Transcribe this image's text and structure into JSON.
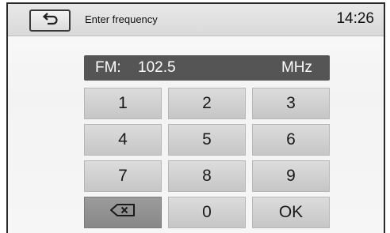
{
  "header": {
    "back_icon": "back-arrow-icon",
    "title": "Enter frequency",
    "time": "14:26"
  },
  "display": {
    "band": "FM:",
    "frequency": "102.5",
    "unit": "MHz"
  },
  "keypad": {
    "keys": [
      "1",
      "2",
      "3",
      "4",
      "5",
      "6",
      "7",
      "8",
      "9"
    ],
    "backspace_icon": "backspace-icon",
    "zero": "0",
    "ok": "OK"
  },
  "colors": {
    "display_background": "#555555",
    "key_background": "#d0d0d0",
    "backspace_key_background": "#929292"
  }
}
